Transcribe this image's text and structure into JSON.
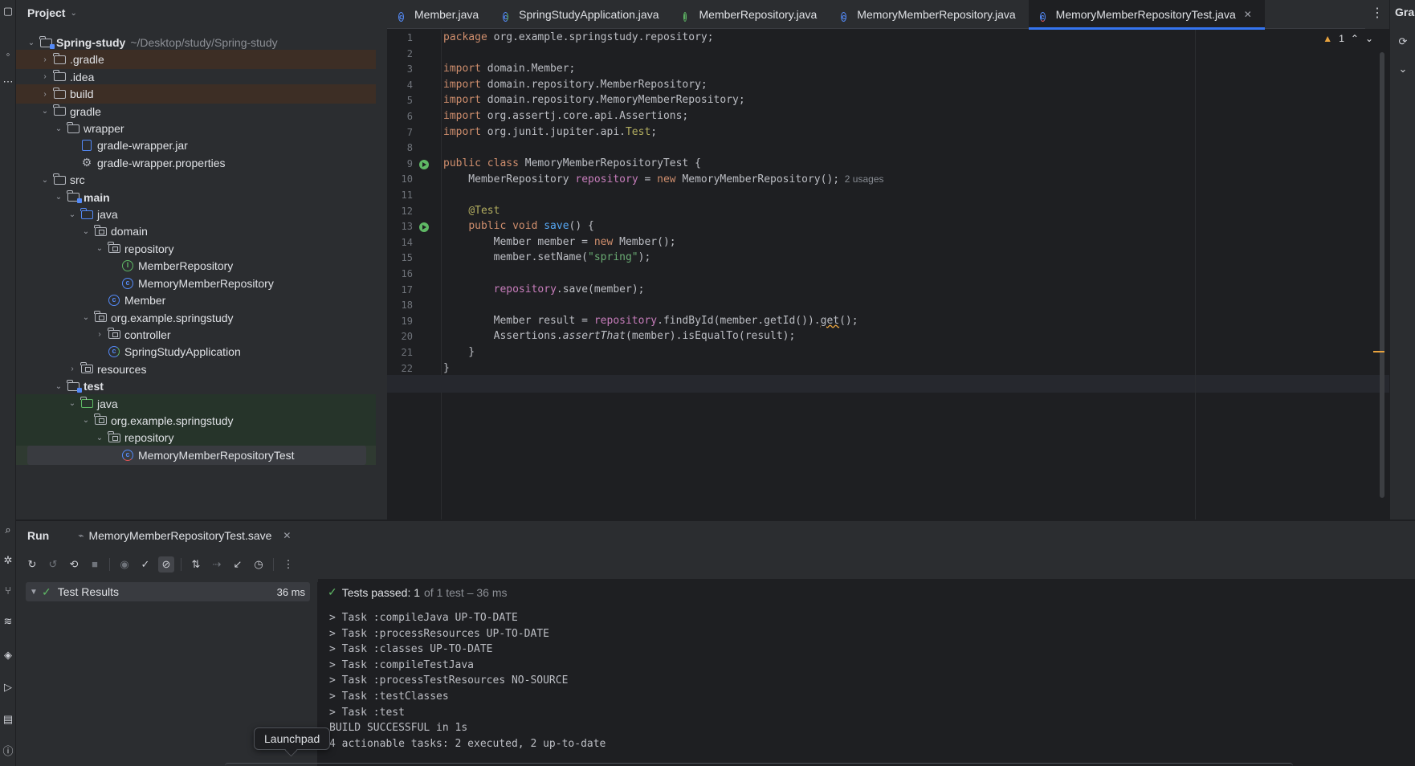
{
  "project": {
    "title": "Project",
    "tree": [
      {
        "label": "Spring-study",
        "path": "~/Desktop/study/Spring-study",
        "depth": 0,
        "arrow": "down",
        "icon": "module-folder",
        "bold": true,
        "style": ""
      },
      {
        "label": ".gradle",
        "depth": 1,
        "arrow": "right",
        "icon": "folder",
        "style": "excluded"
      },
      {
        "label": ".idea",
        "depth": 1,
        "arrow": "right",
        "icon": "folder",
        "style": ""
      },
      {
        "label": "build",
        "depth": 1,
        "arrow": "right",
        "icon": "folder",
        "style": "excluded"
      },
      {
        "label": "gradle",
        "depth": 1,
        "arrow": "down",
        "icon": "folder",
        "style": ""
      },
      {
        "label": "wrapper",
        "depth": 2,
        "arrow": "down",
        "icon": "folder",
        "style": ""
      },
      {
        "label": "gradle-wrapper.jar",
        "depth": 3,
        "arrow": "",
        "icon": "jar",
        "style": ""
      },
      {
        "label": "gradle-wrapper.properties",
        "depth": 3,
        "arrow": "",
        "icon": "gear",
        "style": ""
      },
      {
        "label": "src",
        "depth": 1,
        "arrow": "down",
        "icon": "folder",
        "style": ""
      },
      {
        "label": "main",
        "depth": 2,
        "arrow": "down",
        "icon": "module-folder",
        "bold": true,
        "style": ""
      },
      {
        "label": "java",
        "depth": 3,
        "arrow": "down",
        "icon": "source-folder",
        "style": ""
      },
      {
        "label": "domain",
        "depth": 4,
        "arrow": "down",
        "icon": "package",
        "style": ""
      },
      {
        "label": "repository",
        "depth": 5,
        "arrow": "down",
        "icon": "package",
        "style": ""
      },
      {
        "label": "MemberRepository",
        "depth": 6,
        "arrow": "",
        "icon": "interface",
        "style": ""
      },
      {
        "label": "MemoryMemberRepository",
        "depth": 6,
        "arrow": "",
        "icon": "class",
        "style": ""
      },
      {
        "label": "Member",
        "depth": 5,
        "arrow": "",
        "icon": "class",
        "style": ""
      },
      {
        "label": "org.example.springstudy",
        "depth": 4,
        "arrow": "down",
        "icon": "package",
        "style": ""
      },
      {
        "label": "controller",
        "depth": 5,
        "arrow": "right",
        "icon": "package",
        "style": ""
      },
      {
        "label": "SpringStudyApplication",
        "depth": 5,
        "arrow": "",
        "icon": "spring-class",
        "style": ""
      },
      {
        "label": "resources",
        "depth": 3,
        "arrow": "right",
        "icon": "resources-folder",
        "style": ""
      },
      {
        "label": "test",
        "depth": 2,
        "arrow": "down",
        "icon": "module-folder",
        "bold": true,
        "style": ""
      },
      {
        "label": "java",
        "depth": 3,
        "arrow": "down",
        "icon": "test-folder",
        "style": "testsrc"
      },
      {
        "label": "org.example.springstudy",
        "depth": 4,
        "arrow": "down",
        "icon": "package",
        "style": "testsrc"
      },
      {
        "label": "repository",
        "depth": 5,
        "arrow": "down",
        "icon": "package",
        "style": "testsrc"
      },
      {
        "label": "MemoryMemberRepositoryTest",
        "depth": 6,
        "arrow": "",
        "icon": "test-class",
        "style": "selected"
      }
    ]
  },
  "tabs": [
    {
      "label": "Member.java",
      "icon": "class",
      "active": false
    },
    {
      "label": "SpringStudyApplication.java",
      "icon": "spring-class",
      "active": false
    },
    {
      "label": "MemberRepository.java",
      "icon": "interface",
      "active": false
    },
    {
      "label": "MemoryMemberRepository.java",
      "icon": "class",
      "active": false
    },
    {
      "label": "MemoryMemberRepositoryTest.java",
      "icon": "test-class",
      "active": true
    }
  ],
  "editor": {
    "warning_count": "1",
    "current_line": 23,
    "run_marker_lines": [
      9,
      13
    ],
    "lines": [
      [
        {
          "t": "package",
          "c": "kw"
        },
        {
          "t": " org.example.springstudy.repository;"
        }
      ],
      [],
      [
        {
          "t": "import",
          "c": "kw"
        },
        {
          "t": " domain.Member;"
        }
      ],
      [
        {
          "t": "import",
          "c": "kw"
        },
        {
          "t": " domain.repository.MemberRepository;"
        }
      ],
      [
        {
          "t": "import",
          "c": "kw"
        },
        {
          "t": " domain.repository.MemoryMemberRepository;"
        }
      ],
      [
        {
          "t": "import",
          "c": "kw"
        },
        {
          "t": " org.assertj.core.api.Assertions;"
        }
      ],
      [
        {
          "t": "import",
          "c": "kw"
        },
        {
          "t": " org.junit.jupiter.api."
        },
        {
          "t": "Test",
          "c": "ann"
        },
        {
          "t": ";"
        }
      ],
      [],
      [
        {
          "t": "public class",
          "c": "kw"
        },
        {
          "t": " MemoryMemberRepositoryTest {"
        }
      ],
      [
        {
          "t": "    MemberRepository "
        },
        {
          "t": "repository",
          "c": "fld"
        },
        {
          "t": " = "
        },
        {
          "t": "new",
          "c": "kw"
        },
        {
          "t": " MemoryMemberRepository();"
        },
        {
          "t": "  2 usages",
          "c": "hint"
        }
      ],
      [],
      [
        {
          "t": "    "
        },
        {
          "t": "@Test",
          "c": "ann"
        }
      ],
      [
        {
          "t": "    "
        },
        {
          "t": "public void",
          "c": "kw"
        },
        {
          "t": " "
        },
        {
          "t": "save",
          "c": "fn"
        },
        {
          "t": "() {"
        }
      ],
      [
        {
          "t": "        Member member = "
        },
        {
          "t": "new",
          "c": "kw"
        },
        {
          "t": " Member();"
        }
      ],
      [
        {
          "t": "        member.setName("
        },
        {
          "t": "\"spring\"",
          "c": "str"
        },
        {
          "t": ");"
        }
      ],
      [],
      [
        {
          "t": "        "
        },
        {
          "t": "repository",
          "c": "fld"
        },
        {
          "t": ".save(member);"
        }
      ],
      [],
      [
        {
          "t": "        Member result = "
        },
        {
          "t": "repository",
          "c": "fld"
        },
        {
          "t": ".findById(member.getId())."
        },
        {
          "t": "get",
          "c": "warn-ul"
        },
        {
          "t": "();"
        }
      ],
      [
        {
          "t": "        Assertions."
        },
        {
          "t": "assertThat",
          "c": "it"
        },
        {
          "t": "(member).isEqualTo(result);"
        }
      ],
      [
        {
          "t": "    }"
        }
      ],
      [
        {
          "t": "}"
        }
      ],
      []
    ]
  },
  "right_panel": {
    "title": "Gra"
  },
  "run": {
    "title": "Run",
    "tab_label": "MemoryMemberRepositoryTest.save",
    "results_label": "Test Results",
    "results_time": "36 ms",
    "status_passed": "Tests passed: 1",
    "status_detail": "of 1 test – 36 ms",
    "output": [
      "> Task :compileJava UP-TO-DATE",
      "> Task :processResources UP-TO-DATE",
      "> Task :classes UP-TO-DATE",
      "> Task :compileTestJava",
      "> Task :processTestResources NO-SOURCE",
      "> Task :testClasses",
      "> Task :test",
      "BUILD SUCCESSFUL in 1s",
      "4 actionable tasks: 2 executed, 2 up-to-date"
    ]
  },
  "tooltip": {
    "text": "Launchpad"
  }
}
